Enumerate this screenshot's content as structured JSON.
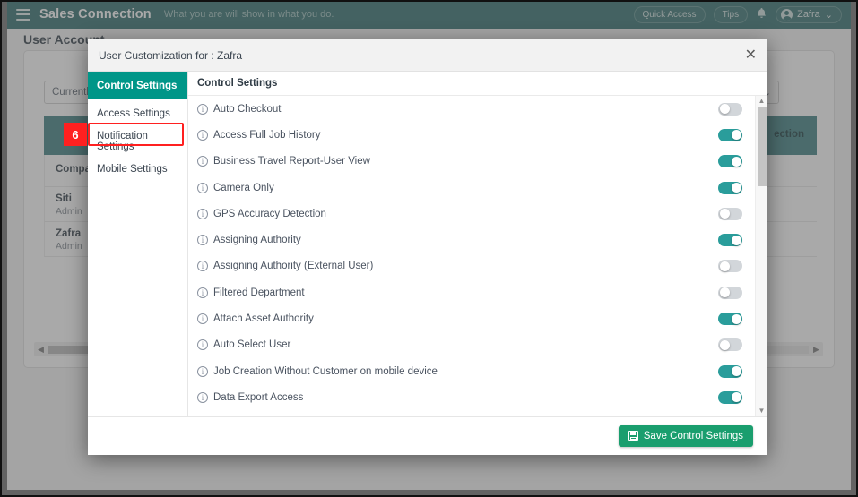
{
  "topbar": {
    "brand": "Sales Connection",
    "tagline": "What you are will show in what you do.",
    "quick_access": "Quick Access",
    "tips": "Tips",
    "user": "Zafra",
    "chevron": "⌄",
    "bell": "🔔"
  },
  "background": {
    "page_title": "User Account",
    "dropdown_value": "Currently Se",
    "dropdown_chevron": "⌄",
    "table_header_label": "ection",
    "rows": [
      {
        "name": "Company S",
        "sub": ""
      },
      {
        "name": "Siti",
        "sub": "Admin"
      },
      {
        "name": "Zafra",
        "sub": "Admin"
      }
    ],
    "scroll_left_arrow": "◀",
    "scroll_right_arrow": "▶"
  },
  "modal": {
    "title": "User Customization for : Zafra",
    "close": "✕",
    "panel_heading": "Control Settings",
    "sidebar": [
      {
        "label": "Control Settings",
        "active": true
      },
      {
        "label": "Access Settings",
        "active": false
      },
      {
        "label": "Notification Settings",
        "active": false
      },
      {
        "label": "Mobile Settings",
        "active": false
      }
    ],
    "settings": [
      {
        "label": "Auto Checkout",
        "state": "off"
      },
      {
        "label": "Access Full Job History",
        "state": "on"
      },
      {
        "label": "Business Travel Report-User View",
        "state": "on"
      },
      {
        "label": "Camera Only",
        "state": "on"
      },
      {
        "label": "GPS Accuracy Detection",
        "state": "off"
      },
      {
        "label": "Assigning Authority",
        "state": "on"
      },
      {
        "label": "Assigning Authority (External User)",
        "state": "off"
      },
      {
        "label": "Filtered Department",
        "state": "off"
      },
      {
        "label": "Attach Asset Authority",
        "state": "on"
      },
      {
        "label": "Auto Select User",
        "state": "off"
      },
      {
        "label": "Job Creation Without Customer on mobile device",
        "state": "on"
      },
      {
        "label": "Data Export Access",
        "state": "on"
      }
    ],
    "info_icon_glyph": "i",
    "save_label": "Save Control Settings",
    "scroll_up_arrow": "▲",
    "scroll_down_arrow": "▼"
  },
  "annotation": {
    "step_number": "6"
  },
  "colors": {
    "topbar": "#2c6b6b",
    "accent_teal": "#009688",
    "toggle_on": "#2a9d9b",
    "toggle_off": "#d2d6da",
    "save_green": "#1a9e6e",
    "annotation_red": "#ff2020"
  }
}
